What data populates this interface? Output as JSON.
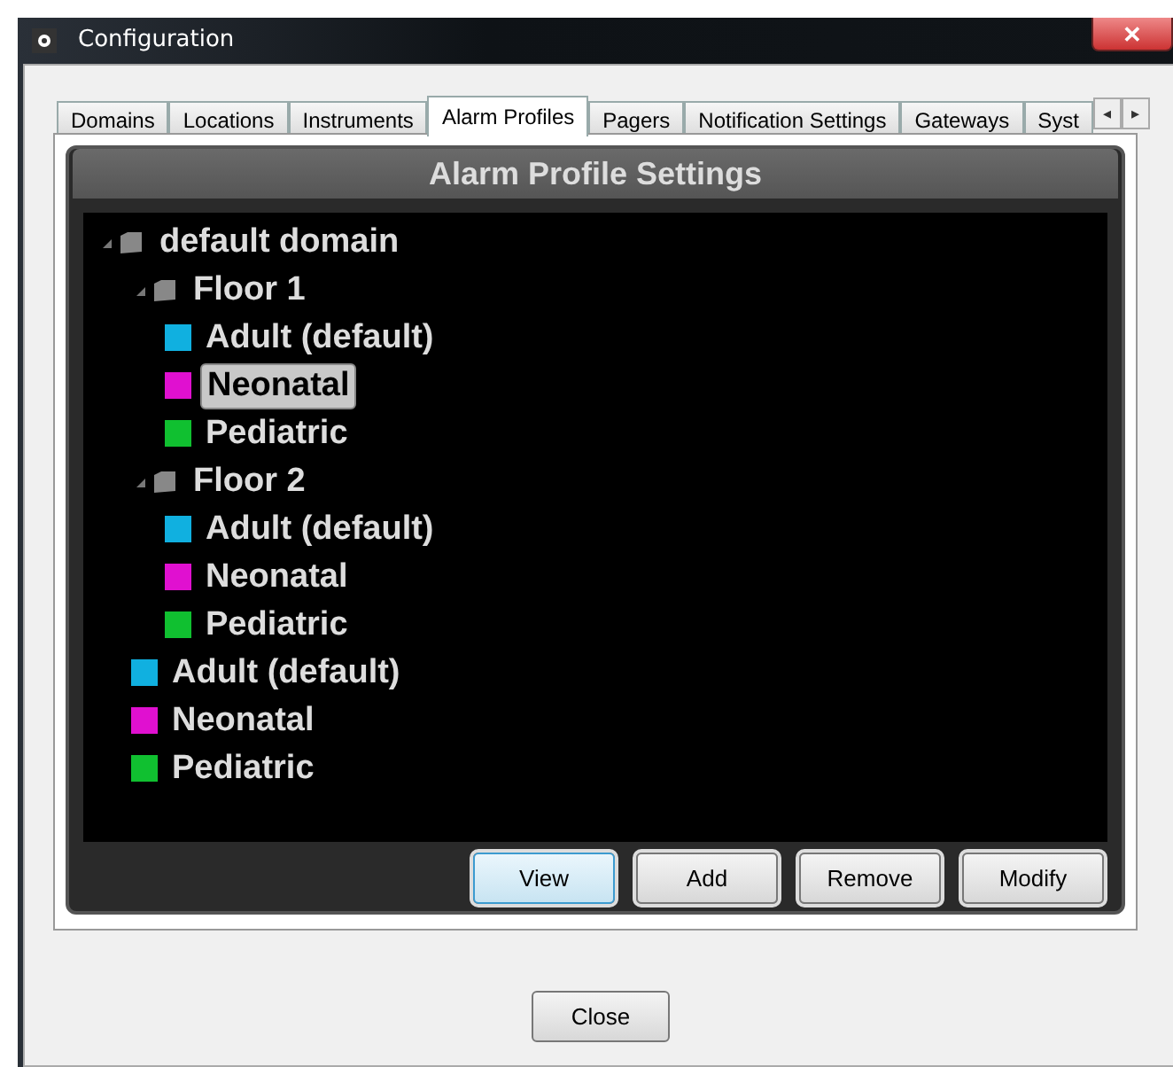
{
  "window": {
    "title": "Configuration",
    "close": "✕"
  },
  "tabs": [
    {
      "label": "Domains",
      "selected": false
    },
    {
      "label": "Locations",
      "selected": false
    },
    {
      "label": "Instruments",
      "selected": false
    },
    {
      "label": "Alarm Profiles",
      "selected": true
    },
    {
      "label": "Pagers",
      "selected": false
    },
    {
      "label": "Notification Settings",
      "selected": false
    },
    {
      "label": "Gateways",
      "selected": false
    },
    {
      "label": "Syst",
      "selected": false
    }
  ],
  "tab_scroll": [
    "◂",
    "▸"
  ],
  "panel": {
    "title": "Alarm Profile Settings"
  },
  "tree": [
    {
      "kind": "folder",
      "label": "default domain",
      "expanded": true,
      "children": [
        {
          "kind": "folder",
          "label": "Floor 1",
          "expanded": true,
          "children": [
            {
              "kind": "profile",
              "label": "Adult (default)",
              "color": "#10b0e0",
              "selected": false
            },
            {
              "kind": "profile",
              "label": "Neonatal",
              "color": "#e010d0",
              "selected": true
            },
            {
              "kind": "profile",
              "label": "Pediatric",
              "color": "#10c030",
              "selected": false
            }
          ]
        },
        {
          "kind": "folder",
          "label": "Floor 2",
          "expanded": true,
          "children": [
            {
              "kind": "profile",
              "label": "Adult (default)",
              "color": "#10b0e0",
              "selected": false
            },
            {
              "kind": "profile",
              "label": "Neonatal",
              "color": "#e010d0",
              "selected": false
            },
            {
              "kind": "profile",
              "label": "Pediatric",
              "color": "#10c030",
              "selected": false
            }
          ]
        },
        {
          "kind": "profile",
          "label": "Adult (default)",
          "color": "#10b0e0",
          "selected": false
        },
        {
          "kind": "profile",
          "label": "Neonatal",
          "color": "#e010d0",
          "selected": false
        },
        {
          "kind": "profile",
          "label": "Pediatric",
          "color": "#10c030",
          "selected": false
        }
      ]
    }
  ],
  "buttons": [
    {
      "label": "View",
      "focused": true
    },
    {
      "label": "Add",
      "focused": false
    },
    {
      "label": "Remove",
      "focused": false
    },
    {
      "label": "Modify",
      "focused": false
    }
  ],
  "footer_button": "Close"
}
